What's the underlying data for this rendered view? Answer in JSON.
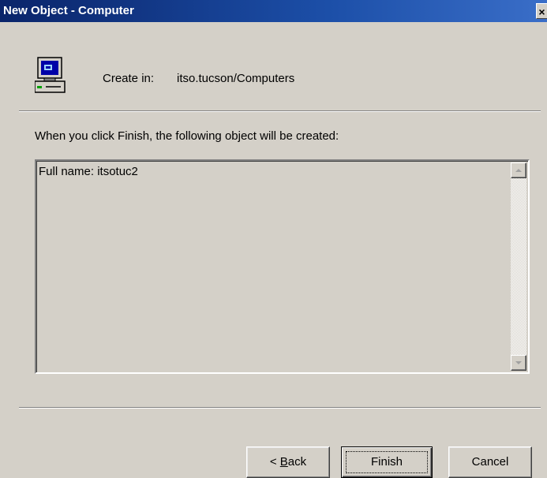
{
  "window": {
    "title": "New Object - Computer",
    "close_glyph": "×"
  },
  "header": {
    "icon": "computer-icon",
    "create_in_label": "Create in:",
    "create_in_path": "itso.tucson/Computers"
  },
  "main": {
    "info_text": "When you click Finish, the following object will be created:",
    "summary_text": "Full name: itsotuc2"
  },
  "buttons": {
    "back_prefix": "< ",
    "back_mnemonic": "B",
    "back_rest": "ack",
    "finish": "Finish",
    "cancel": "Cancel"
  },
  "colors": {
    "title_bar": "#0a246a",
    "dialog_face": "#d4d0c8"
  }
}
